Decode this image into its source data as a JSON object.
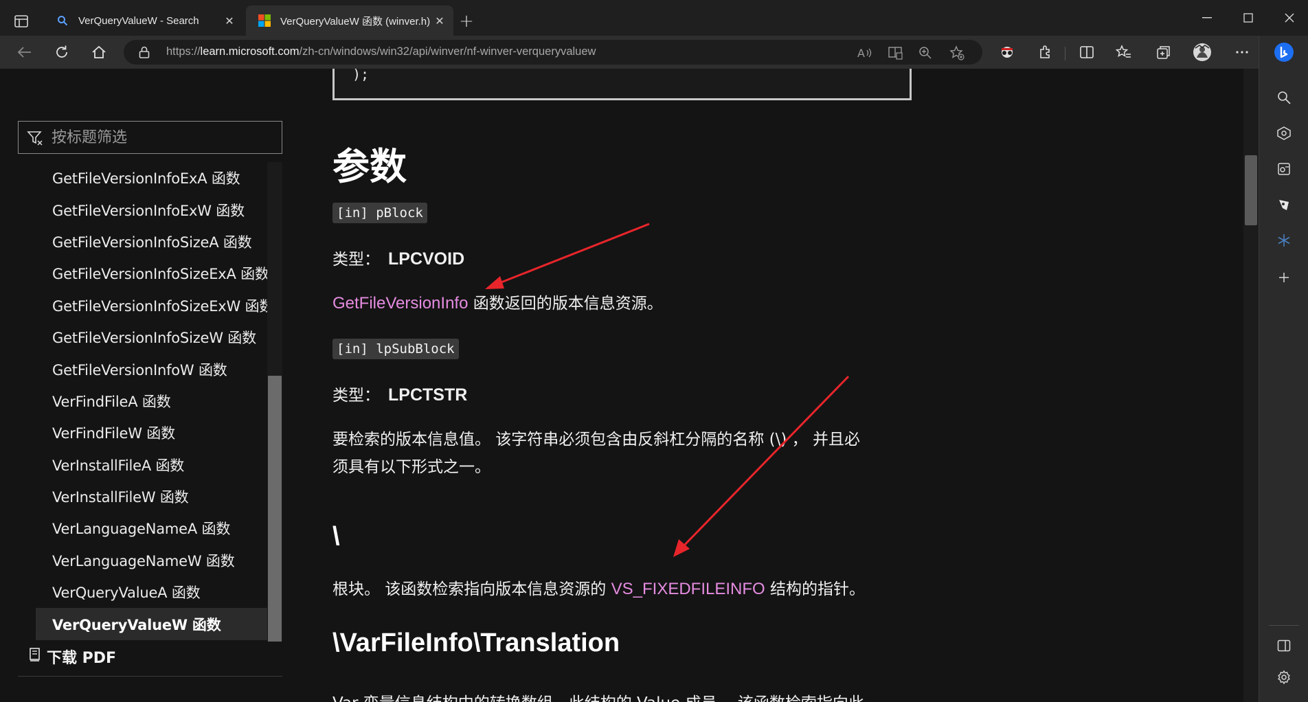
{
  "browser": {
    "tabs": [
      {
        "title": "VerQueryValueW - Search",
        "favicon": "search-icon"
      },
      {
        "title": "VerQueryValueW 函数 (winver.h)",
        "favicon": "microsoft-logo-icon",
        "active": true
      }
    ],
    "new_tab_label": "+",
    "address": {
      "scheme": "https://",
      "host": "learn.microsoft.com",
      "path": "/zh-cn/windows/win32/api/winver/nf-winver-verqueryvaluew"
    }
  },
  "sidebar": {
    "filter_placeholder": "按标题筛选",
    "items": [
      {
        "label": "GetFileVersionInfoExA 函数"
      },
      {
        "label": "GetFileVersionInfoExW 函数"
      },
      {
        "label": "GetFileVersionInfoSizeA 函数"
      },
      {
        "label": "GetFileVersionInfoSizeExA 函数"
      },
      {
        "label": "GetFileVersionInfoSizeExW 函数"
      },
      {
        "label": "GetFileVersionInfoSizeW 函数"
      },
      {
        "label": "GetFileVersionInfoW 函数"
      },
      {
        "label": "VerFindFileA 函数"
      },
      {
        "label": "VerFindFileW 函数"
      },
      {
        "label": "VerInstallFileA 函数"
      },
      {
        "label": "VerInstallFileW 函数"
      },
      {
        "label": "VerLanguageNameA 函数"
      },
      {
        "label": "VerLanguageNameW 函数"
      },
      {
        "label": "VerQueryValueA 函数"
      },
      {
        "label": "VerQueryValueW 函数",
        "active": true
      }
    ],
    "download_pdf": "下载 PDF"
  },
  "content": {
    "code_tail": ");",
    "params_heading": "参数",
    "param1": {
      "tag": "[in] pBlock",
      "type_label": "类型：",
      "type_value": "LPCVOID",
      "desc_link": "GetFileVersionInfo",
      "desc_rest": " 函数返回的版本信息资源。"
    },
    "param2": {
      "tag": "[in] lpSubBlock",
      "type_label": "类型：",
      "type_value": "LPCTSTR",
      "desc_line1": "要检索的版本信息值。 该字符串必须包含由反斜杠分隔的名称 (\\) ， 并且必",
      "desc_line2": "须具有以下形式之一。"
    },
    "root": {
      "heading": "\\",
      "desc_before": "根块。 该函数检索指向版本信息资源的 ",
      "desc_link": "VS_FIXEDFILEINFO",
      "desc_after": " 结构的指针。"
    },
    "translation": {
      "heading": "\\VarFileInfo\\Translation",
      "desc_partial": "Var 变量信息结构中的转换数组 - 此结构的 Value 成员。 该函数检索指向此"
    }
  },
  "colors": {
    "link": "#e58ce0",
    "annotation_arrow": "#e8252b",
    "page_bg": "#141414"
  }
}
